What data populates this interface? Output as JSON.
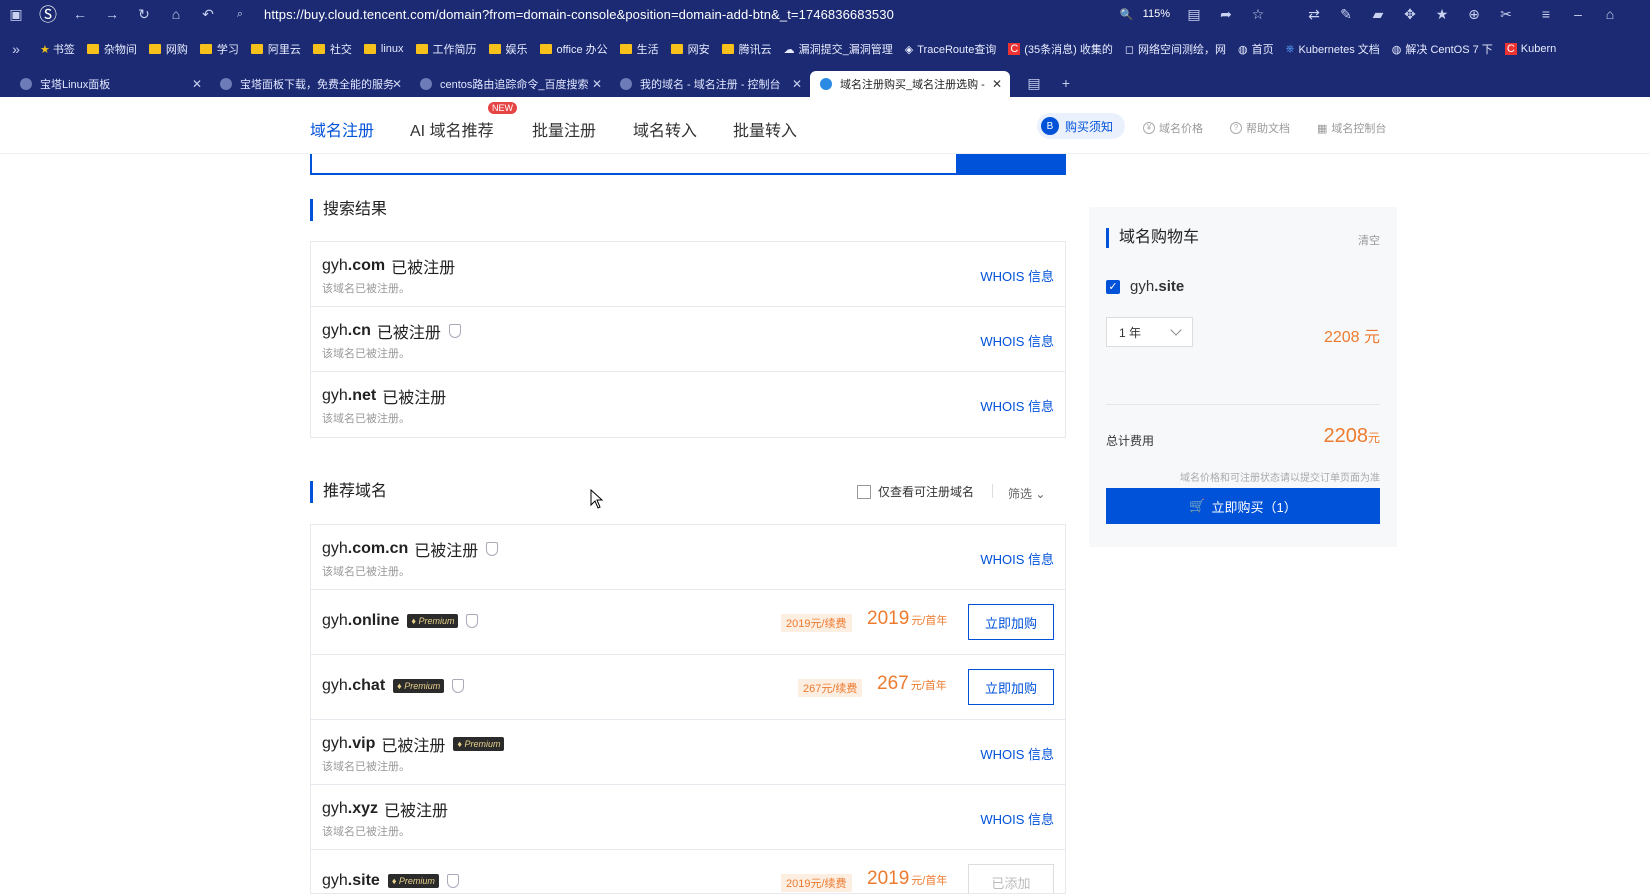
{
  "browser": {
    "url": "https://buy.cloud.tencent.com/domain?from=domain-console&position=domain-add-btn&_t=1746836683530",
    "zoom": "115%",
    "bookmarks": [
      "书签",
      "杂物间",
      "网购",
      "学习",
      "阿里云",
      "社交",
      "linux",
      "工作简历",
      "娱乐",
      "office 办公",
      "生活",
      "网安",
      "腾讯云",
      "漏洞提交_漏洞管理",
      "TraceRoute查询",
      "(35条消息) 收集的",
      "网络空间测绘，网",
      "首页",
      "Kubernetes 文档",
      "解决 CentOS 7 下",
      "Kubern"
    ],
    "tabs": [
      {
        "title": "宝塔Linux面板"
      },
      {
        "title": "宝塔面板下载，免费全能的服务"
      },
      {
        "title": "centos路由追踪命令_百度搜索"
      },
      {
        "title": "我的域名 - 域名注册 - 控制台"
      },
      {
        "title": "域名注册购买_域名注册选购 -"
      }
    ]
  },
  "nav": {
    "items": [
      "域名注册",
      "AI 域名推荐",
      "批量注册",
      "域名转入",
      "批量转入"
    ],
    "new_badge": "NEW",
    "notice": "购买须知",
    "notice_icon_letter": "B",
    "links": [
      "域名价格",
      "帮助文档",
      "域名控制台"
    ]
  },
  "search_results": {
    "title": "搜索结果",
    "items": [
      {
        "prefix": "gyh",
        "suffix": ".com",
        "status": "已被注册",
        "sub": "该域名已被注册。",
        "action": "WHOIS 信息"
      },
      {
        "prefix": "gyh",
        "suffix": ".cn",
        "status": "已被注册",
        "sub": "该域名已被注册。",
        "action": "WHOIS 信息"
      },
      {
        "prefix": "gyh",
        "suffix": ".net",
        "status": "已被注册",
        "sub": "该域名已被注册。",
        "action": "WHOIS 信息"
      }
    ]
  },
  "recommend": {
    "title": "推荐域名",
    "only_available": "仅查看可注册域名",
    "filter": "筛选",
    "premium": "Premium",
    "items": [
      {
        "prefix": "gyh",
        "suffix": ".com.cn",
        "status": "已被注册",
        "sub": "该域名已被注册。",
        "action": "WHOIS 信息"
      },
      {
        "prefix": "gyh",
        "suffix": ".online",
        "renew": "2019元/续费",
        "price": "2019",
        "unit": "元/首年",
        "action": "立即加购"
      },
      {
        "prefix": "gyh",
        "suffix": ".chat",
        "renew": "267元/续费",
        "price": "267",
        "unit": "元/首年",
        "action": "立即加购"
      },
      {
        "prefix": "gyh",
        "suffix": ".vip",
        "status": "已被注册",
        "sub": "该域名已被注册。",
        "action": "WHOIS 信息"
      },
      {
        "prefix": "gyh",
        "suffix": ".xyz",
        "status": "已被注册",
        "sub": "该域名已被注册。",
        "action": "WHOIS 信息"
      },
      {
        "prefix": "gyh",
        "suffix": ".site",
        "renew": "2019元/续费",
        "price": "2019",
        "unit": "元/首年",
        "action": "已添加"
      }
    ]
  },
  "cart": {
    "title": "域名购物车",
    "clear": "清空",
    "item_prefix": "gyh",
    "item_suffix": ".site",
    "year": "1 年",
    "item_price": "2208 元",
    "total_label": "总计费用",
    "total_value": "2208",
    "total_unit": "元",
    "note": "域名价格和可注册状态请以提交订单页面为准",
    "buy": "立即购买（1）"
  }
}
